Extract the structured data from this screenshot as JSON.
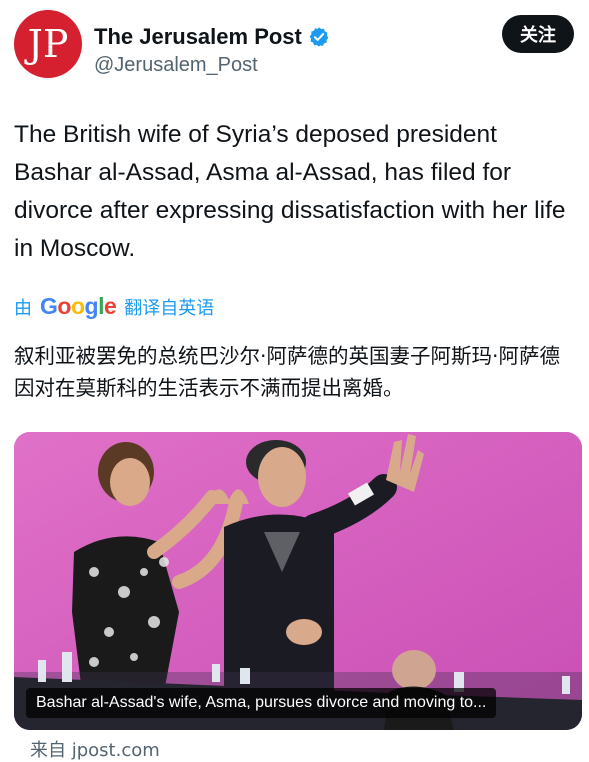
{
  "account": {
    "avatar_text": "JP",
    "name": "The Jerusalem Post",
    "handle": "@Jerusalem_Post",
    "follow_label": "关注"
  },
  "tweet": {
    "text": "The British wife of Syria’s deposed president Bashar al-Assad, Asma al-Assad, has filed for divorce after expressing dissatisfaction with her life in Moscow."
  },
  "translation": {
    "prefix": "由",
    "google": [
      "G",
      "o",
      "o",
      "g",
      "l",
      "e"
    ],
    "link": "翻译自英语",
    "text": "叙利亚被罢免的总统巴沙尔·阿萨德的英国妻子阿斯玛·阿萨德因对在莫斯科的生活表示不满而提出离婚。"
  },
  "card": {
    "caption": "Bashar al-Assad's wife, Asma, pursues divorce and moving to...",
    "source": "来自 jpost.com"
  },
  "colors": {
    "accent": "#1d9bf0",
    "brand": "#d4202f",
    "background_pink": "#d85fc0"
  }
}
